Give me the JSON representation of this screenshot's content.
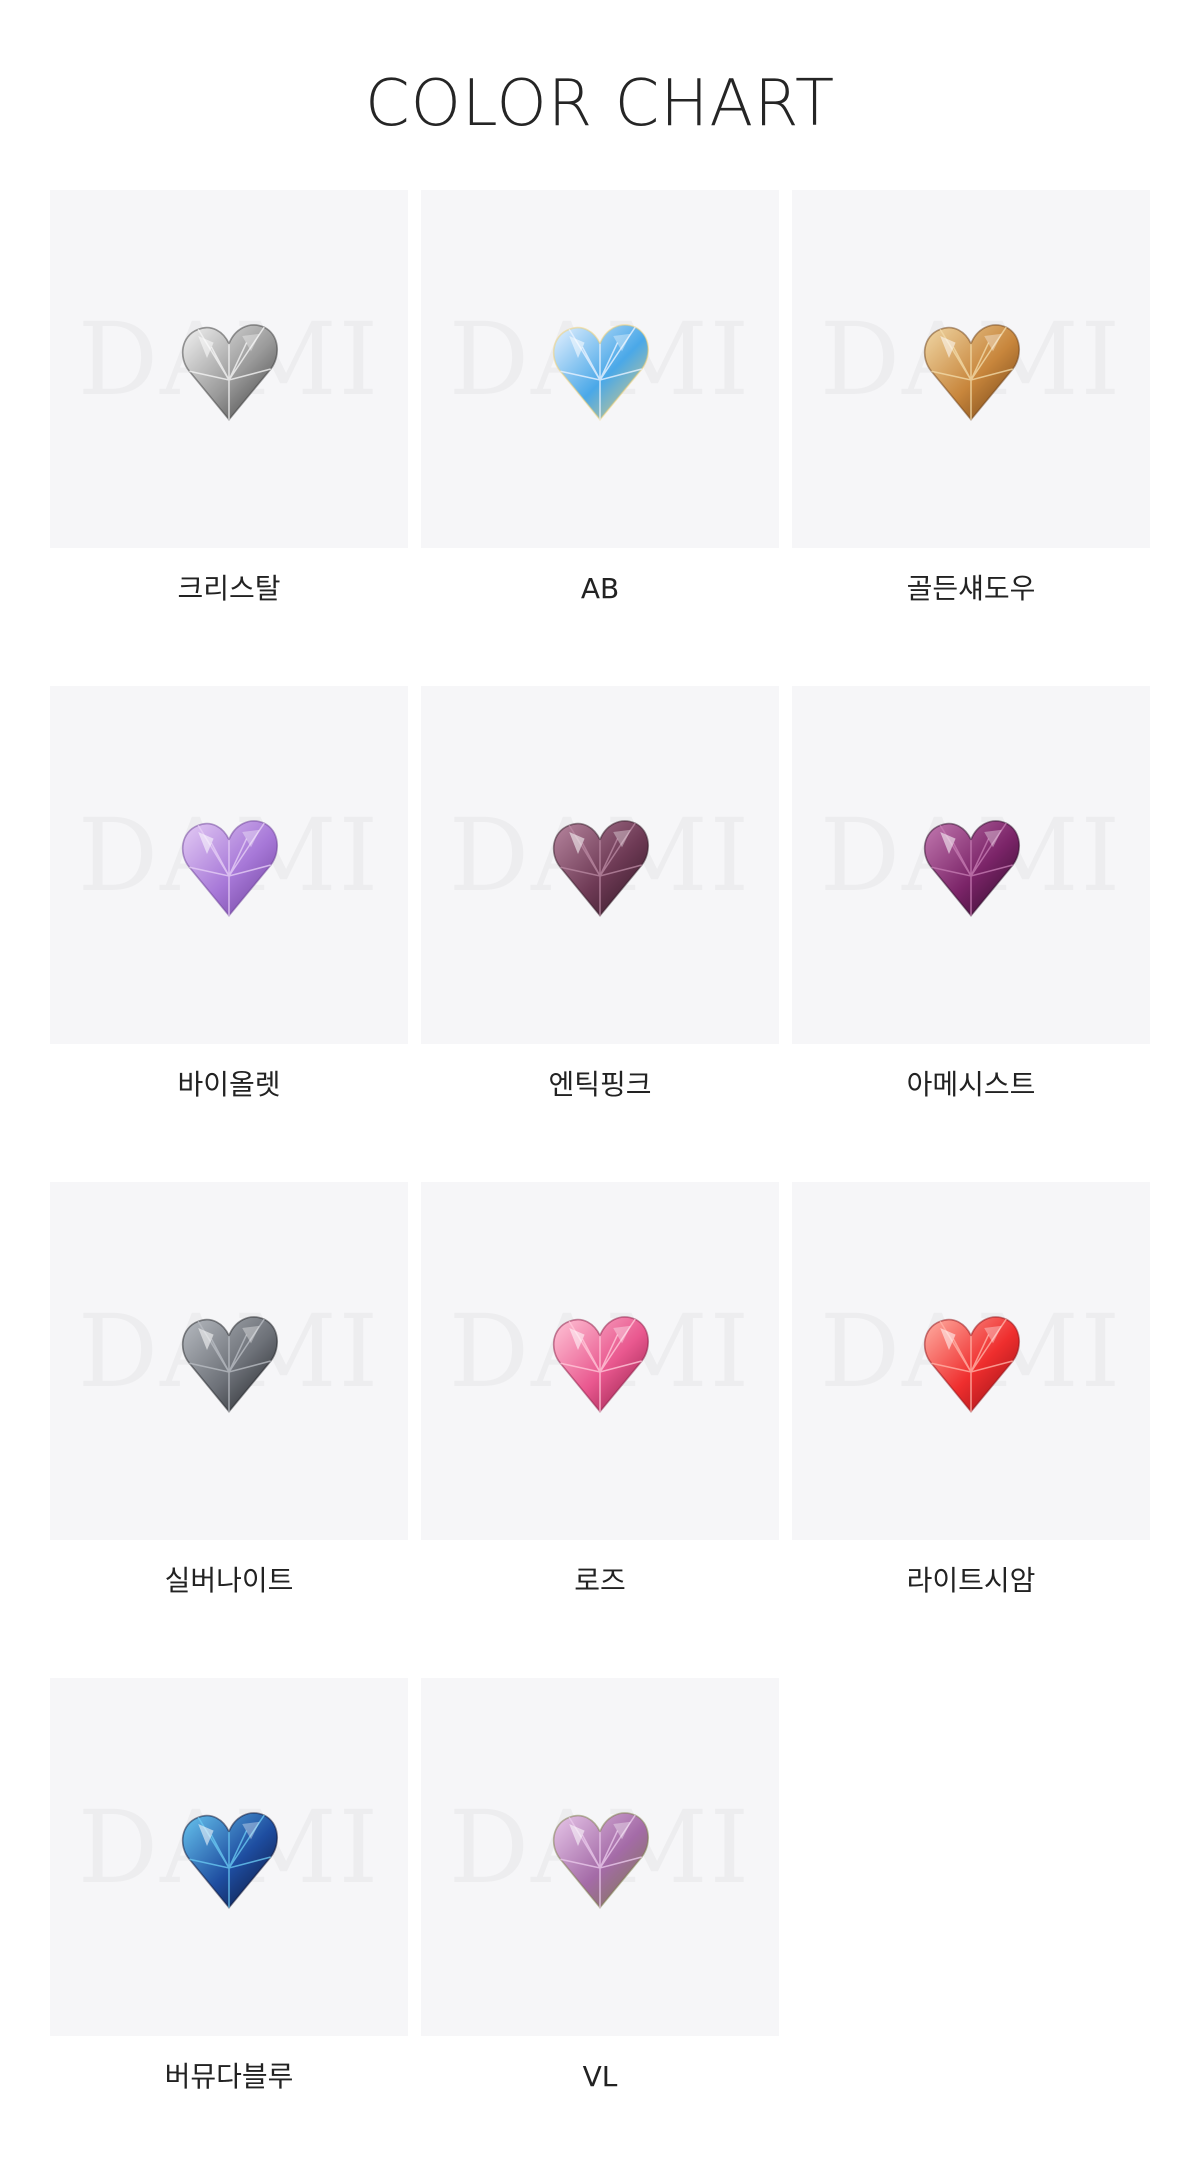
{
  "page": {
    "title": "COLOR CHART"
  },
  "watermark_text": "DAMI",
  "swatches": [
    {
      "label": "크리스탈",
      "colors": [
        "#f4f4f4",
        "#9a9a9a",
        "#3a3a3a"
      ],
      "icon": "heart-crystal-icon"
    },
    {
      "label": "AB",
      "colors": [
        "#e8f2ff",
        "#4aa8e8",
        "#f2d070"
      ],
      "icon": "heart-ab-icon"
    },
    {
      "label": "골든섀도우",
      "colors": [
        "#f1d9a8",
        "#c8863c",
        "#6b3e14"
      ],
      "icon": "heart-golden-shadow-icon"
    },
    {
      "label": "바이올렛",
      "colors": [
        "#e5cdf5",
        "#a778d8",
        "#6a3d96"
      ],
      "icon": "heart-violet-icon"
    },
    {
      "label": "엔틱핑크",
      "colors": [
        "#b887a0",
        "#6e3a55",
        "#2e1522"
      ],
      "icon": "heart-antique-pink-icon"
    },
    {
      "label": "아메시스트",
      "colors": [
        "#c47bb2",
        "#7b2468",
        "#2a0a26"
      ],
      "icon": "heart-amethyst-icon"
    },
    {
      "label": "실버나이트",
      "colors": [
        "#b8bcc2",
        "#6d7178",
        "#1e2024"
      ],
      "icon": "heart-silver-night-icon"
    },
    {
      "label": "로즈",
      "colors": [
        "#ffc7d8",
        "#e9588f",
        "#8a1842"
      ],
      "icon": "heart-rose-icon"
    },
    {
      "label": "라이트시암",
      "colors": [
        "#ffb2a6",
        "#ef2e2e",
        "#8e0d13"
      ],
      "icon": "heart-light-siam-icon"
    },
    {
      "label": "버뮤다블루",
      "colors": [
        "#69c7f0",
        "#1e4da0",
        "#0b1030"
      ],
      "icon": "heart-bermuda-blue-icon"
    },
    {
      "label": "VL",
      "colors": [
        "#e8c8ea",
        "#a46ba7",
        "#7a7a45"
      ],
      "icon": "heart-vl-icon"
    }
  ]
}
